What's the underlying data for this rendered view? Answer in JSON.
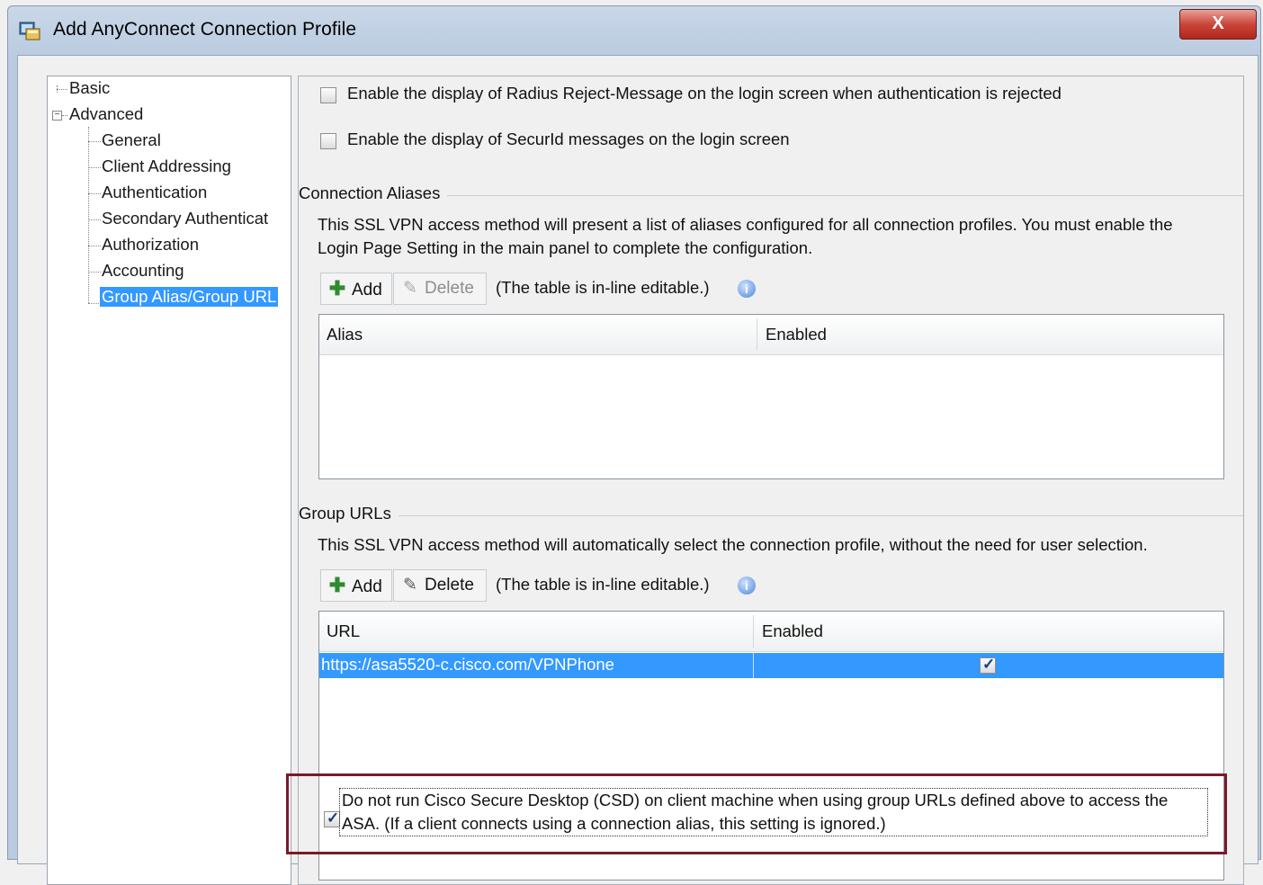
{
  "window": {
    "title": "Add AnyConnect Connection Profile",
    "close_label": "X"
  },
  "tree": {
    "items": [
      {
        "label": "Basic"
      },
      {
        "label": "Advanced"
      },
      {
        "label": "General"
      },
      {
        "label": "Client Addressing"
      },
      {
        "label": "Authentication"
      },
      {
        "label": "Secondary Authenticat"
      },
      {
        "label": "Authorization"
      },
      {
        "label": "Accounting"
      },
      {
        "label": "Group Alias/Group URL",
        "selected": true
      }
    ]
  },
  "options": {
    "radius_reject": {
      "label": "Enable the display of Radius Reject-Message on the login screen when authentication is rejected",
      "checked": false
    },
    "securid": {
      "label": "Enable the display of SecurId messages on the login screen",
      "checked": false
    }
  },
  "aliases": {
    "section_title": "Connection Aliases",
    "description_line1": "This SSL VPN access method will present a list of aliases configured for all connection profiles. You must enable the",
    "description_line2": "Login Page Setting in the main panel to complete the configuration.",
    "add_label": "Add",
    "delete_label": "Delete",
    "hint": "(The table is in-line editable.)",
    "columns": [
      "Alias",
      "Enabled"
    ],
    "rows": []
  },
  "urls": {
    "section_title": "Group URLs",
    "description": "This SSL VPN access method will automatically select the connection profile, without the need for user selection.",
    "add_label": "Add",
    "delete_label": "Delete",
    "hint": "(The table is in-line editable.)",
    "columns": [
      "URL",
      "Enabled"
    ],
    "rows": [
      {
        "url": "https://asa5520-c.cisco.com/VPNPhone",
        "enabled": true
      }
    ]
  },
  "csd": {
    "line1": "Do not run Cisco Secure Desktop (CSD) on client machine when using group URLs defined above to access the",
    "line2": "ASA. (If a client connects using a connection alias, this setting is ignored.)",
    "checked": true
  }
}
